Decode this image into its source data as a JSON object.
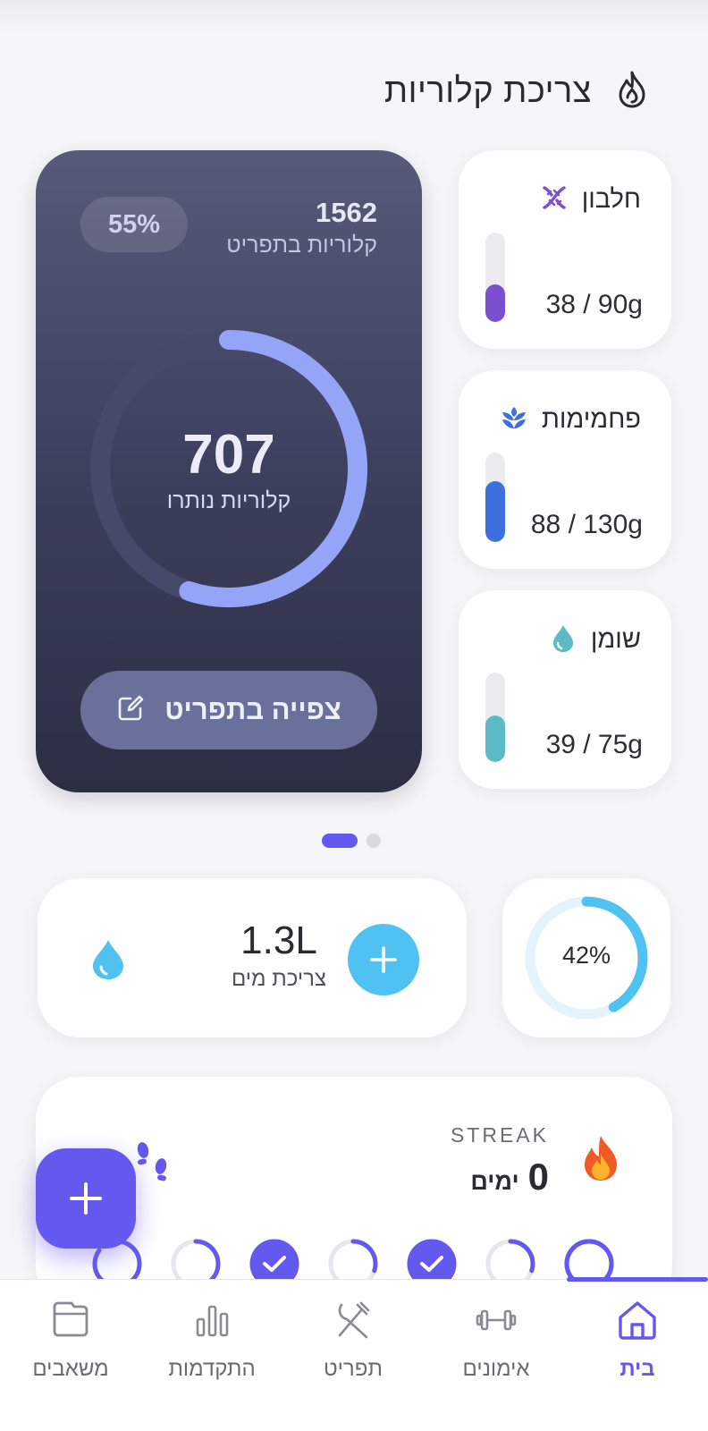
{
  "section": {
    "title": "צריכת קלוריות",
    "icon": "flame-outline-icon"
  },
  "calorie_card": {
    "percent": "55%",
    "consumed_value": "1562",
    "consumed_label": "קלוריות בתפריט",
    "remaining_value": "707",
    "remaining_label": "קלוריות נותרו",
    "progress_fraction": 0.55,
    "view_button_label": "צפייה בתפריט",
    "colors": {
      "ring": "#94a5f7",
      "track": "#464a6a"
    }
  },
  "macros": [
    {
      "name": "חלבון",
      "value": "38 / 90g",
      "current": 38,
      "goal": 90,
      "color": "#7a4fd0",
      "icon": "dna-icon"
    },
    {
      "name": "פחמימות",
      "value": "88 / 130g",
      "current": 88,
      "goal": 130,
      "color": "#3d6fde",
      "icon": "wheat-icon"
    },
    {
      "name": "שומן",
      "value": "39 / 75g",
      "current": 39,
      "goal": 75,
      "color": "#5bbac4",
      "icon": "oil-drop-icon"
    }
  ],
  "pager": {
    "pages": 2,
    "active_index": 1
  },
  "water": {
    "value": "1.3L",
    "label": "צריכת מים",
    "accent": "#4fc2f1"
  },
  "water_goal": {
    "percent": "42%",
    "fraction": 0.42
  },
  "streak": {
    "caption": "STREAK",
    "days_value": "0",
    "days_unit": "ימים",
    "week_days": [
      {
        "state": "partial",
        "fraction": 0.85
      },
      {
        "state": "partial",
        "fraction": 0.55
      },
      {
        "state": "done"
      },
      {
        "state": "partial",
        "fraction": 0.3
      },
      {
        "state": "done"
      },
      {
        "state": "partial",
        "fraction": 0.3
      },
      {
        "state": "empty"
      }
    ]
  },
  "fab": {
    "icon": "plus-icon"
  },
  "nav": {
    "active": "home",
    "items": [
      {
        "key": "home",
        "label": "בית",
        "icon": "home-icon"
      },
      {
        "key": "workouts",
        "label": "אימונים",
        "icon": "dumbbell-icon"
      },
      {
        "key": "menu",
        "label": "תפריט",
        "icon": "utensils-icon"
      },
      {
        "key": "progress",
        "label": "התקדמות",
        "icon": "bar-chart-icon"
      },
      {
        "key": "resources",
        "label": "משאבים",
        "icon": "folder-icon"
      }
    ]
  }
}
